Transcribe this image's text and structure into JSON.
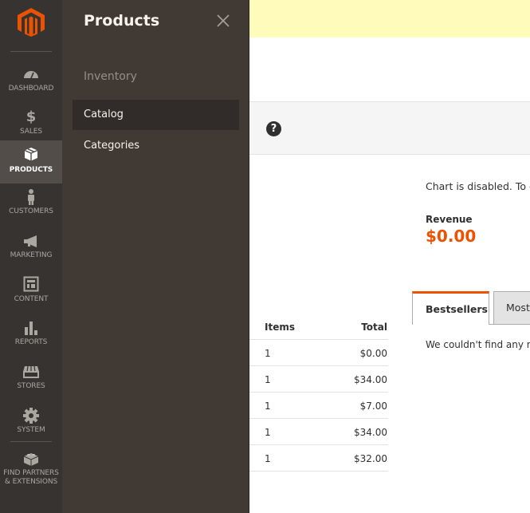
{
  "nav": {
    "logo": "magento-logo",
    "items": [
      {
        "label": "DASHBOARD",
        "icon": "dashboard-gauge-icon"
      },
      {
        "label": "SALES",
        "icon": "dollar-icon"
      },
      {
        "label": "PRODUCTS",
        "icon": "box-icon",
        "active": true
      },
      {
        "label": "CUSTOMERS",
        "icon": "person-icon"
      },
      {
        "label": "MARKETING",
        "icon": "megaphone-icon"
      },
      {
        "label": "CONTENT",
        "icon": "layout-icon"
      },
      {
        "label": "REPORTS",
        "icon": "bar-chart-icon"
      },
      {
        "label": "STORES",
        "icon": "storefront-icon"
      },
      {
        "label": "SYSTEM",
        "icon": "gear-icon"
      },
      {
        "label": "FIND PARTNERS & EXTENSIONS",
        "icon": "brick-icon"
      }
    ],
    "extensions_line1": "FIND PARTNERS",
    "extensions_line2": "& EXTENSIONS"
  },
  "submenu": {
    "title": "Products",
    "close_icon": "close-icon",
    "group_label": "Inventory",
    "items": [
      {
        "label": "Catalog",
        "active": true
      },
      {
        "label": "Categories"
      }
    ]
  },
  "page": {
    "help_glyph": "?",
    "chart_message": "Chart is disabled. To en",
    "revenue_label": "Revenue",
    "revenue_value": "$0.00",
    "tabs": [
      {
        "label": "Bestsellers",
        "active": true
      },
      {
        "label": "Most"
      }
    ],
    "no_records": "We couldn't find any reco",
    "orders_table": {
      "headers": {
        "items": "Items",
        "total": "Total"
      },
      "rows": [
        {
          "items": "1",
          "total": "$0.00"
        },
        {
          "items": "1",
          "total": "$34.00"
        },
        {
          "items": "1",
          "total": "$7.00"
        },
        {
          "items": "1",
          "total": "$34.00"
        },
        {
          "items": "1",
          "total": "$32.00"
        }
      ]
    }
  },
  "colors": {
    "accent": "#eb5202",
    "nav_bg": "#373330",
    "submenu_bg": "#403934",
    "notice_bg": "#fffbbb"
  }
}
